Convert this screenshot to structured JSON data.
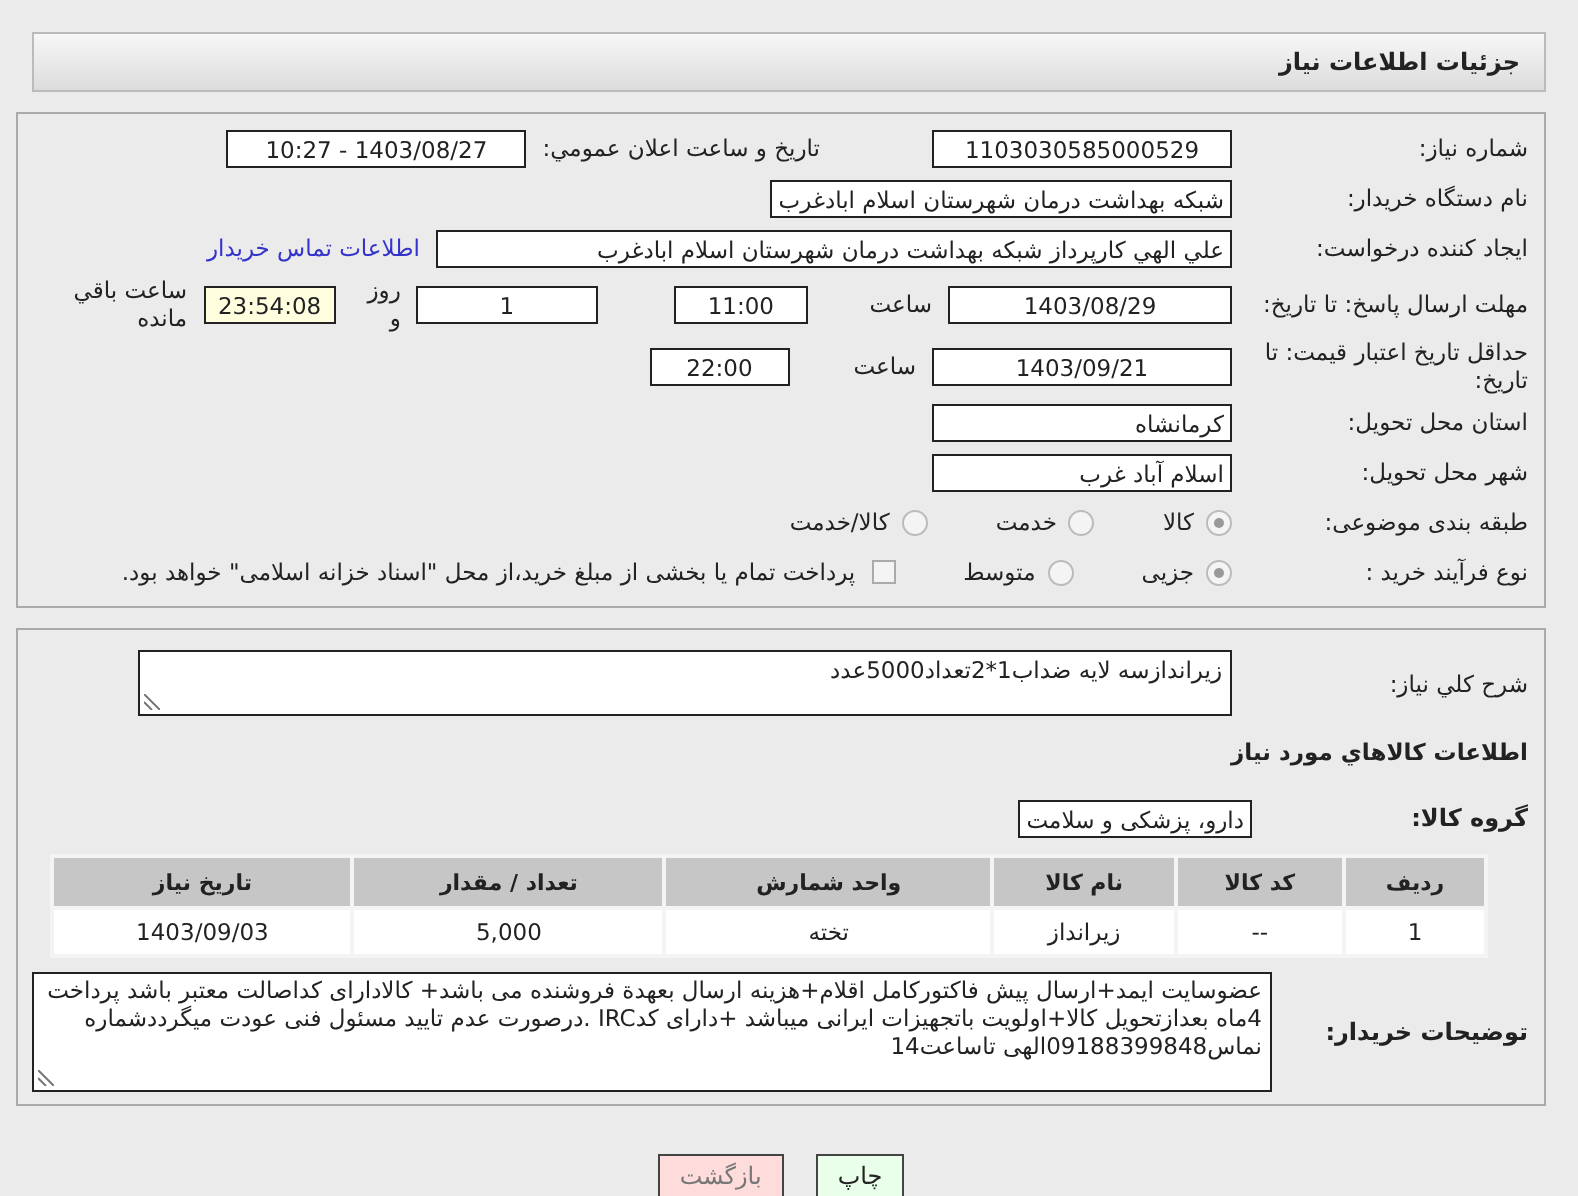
{
  "header": {
    "title": "جزئیات اطلاعات نیاز"
  },
  "need_number": {
    "label": "شماره نیاز:",
    "value": "1103030585000529"
  },
  "announce": {
    "label": "تاریخ و ساعت اعلان عمومي:",
    "value": "1403/08/27 - 10:27"
  },
  "buyer_org": {
    "label": "نام دستگاه خریدار:",
    "value": "شبکه بهداشت درمان شهرستان اسلام ابادغرب"
  },
  "requester": {
    "label": "ایجاد کننده درخواست:",
    "value": "علي الهي کارپرداز شبکه بهداشت درمان شهرستان اسلام ابادغرب",
    "link": "اطلاعات تماس خریدار"
  },
  "reply_deadline": {
    "label": "مهلت ارسال پاسخ: تا تاریخ:",
    "date": "1403/08/29",
    "time_label": "ساعت",
    "time": "11:00",
    "days": "1",
    "days_label": "روز و",
    "remaining": "23:54:08",
    "remaining_label": "ساعت باقي مانده"
  },
  "price_validity": {
    "label": "حداقل تاریخ اعتبار قیمت: تا تاریخ:",
    "date": "1403/09/21",
    "time_label": "ساعت",
    "time": "22:00"
  },
  "province": {
    "label": "استان محل تحویل:",
    "value": "کرمانشاه"
  },
  "city": {
    "label": "شهر محل تحویل:",
    "value": "اسلام آباد غرب"
  },
  "category": {
    "label": "طبقه بندی موضوعی:",
    "disabled": true,
    "options": [
      {
        "label": "کالا",
        "selected": true
      },
      {
        "label": "خدمت",
        "selected": false
      },
      {
        "label": "کالا/خدمت",
        "selected": false
      }
    ]
  },
  "purchase_type": {
    "label": "نوع فرآیند خرید :",
    "disabled": true,
    "options": [
      {
        "label": "جزیی",
        "selected": true
      },
      {
        "label": "متوسط",
        "selected": false
      }
    ],
    "payment": {
      "checked": false,
      "text": "پرداخت تمام یا بخشی از مبلغ خرید،از محل \"اسناد خزانه اسلامی\" خواهد بود."
    }
  },
  "summary": {
    "label": "شرح کلي نیاز:",
    "value": "زیراندازسه لایه ضداب1*2تعداد5000عدد"
  },
  "goods_heading": "اطلاعات کالاهاي مورد نیاز",
  "goods_group": {
    "label": "گروه کالا:",
    "value": "دارو، پزشکی و سلامت"
  },
  "table": {
    "columns": [
      "ردیف",
      "کد کالا",
      "نام کالا",
      "واحد شمارش",
      "تعداد / مقدار",
      "تاریخ نیاز"
    ],
    "rows": [
      [
        "1",
        "--",
        "زیرانداز",
        "تخته",
        "5,000",
        "1403/09/03"
      ]
    ]
  },
  "buyer_notes": {
    "label": "توضیحات خریدار:",
    "value": "عضوسایت ایمد+ارسال پیش فاکتورکامل اقلام+هزینه ارسال بعهدة فروشنده می باشد+ کالادارای کداصالت معتبر باشد پرداخت 4ماه بعدازتحویل کالا+اولویت باتجهیزات ایرانی میباشد +دارای کدIRC .درصورت عدم تایید مسئول فنی عودت میگرددشماره نماس09188399848الهی تاساعت14"
  },
  "buttons": [
    {
      "label": "چاپ",
      "kind": "print"
    },
    {
      "label": "بازگشت",
      "kind": "back"
    }
  ]
}
